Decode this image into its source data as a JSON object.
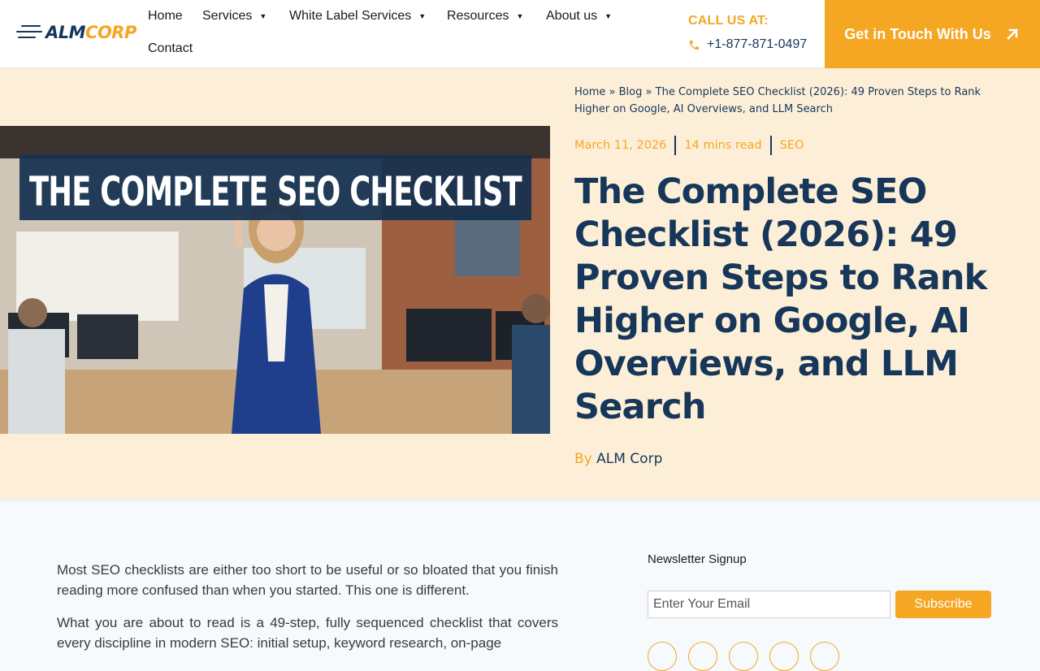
{
  "brand": {
    "alm": "ALM",
    "corp": "CORP"
  },
  "nav": [
    {
      "label": "Home",
      "has_dropdown": false
    },
    {
      "label": "Services",
      "has_dropdown": true
    },
    {
      "label": "White Label Services",
      "has_dropdown": true
    },
    {
      "label": "Resources",
      "has_dropdown": true
    },
    {
      "label": "About us",
      "has_dropdown": true
    },
    {
      "label": "Contact",
      "has_dropdown": false
    }
  ],
  "contact": {
    "label": "CALL US AT:",
    "phone": "+1-877-871-0497"
  },
  "cta": {
    "label": "Get in Touch With Us"
  },
  "hero": {
    "image_text": "THE COMPLETE SEO CHECKLIST",
    "breadcrumb": {
      "home": "Home",
      "blog": "Blog",
      "current": "The Complete SEO Checklist (2026): 49 Proven Steps to Rank Higher on Google, AI Overviews, and LLM Search",
      "separator": "»"
    },
    "date": "March 11, 2026",
    "read_time": "14 mins read",
    "category": "SEO",
    "title": "The Complete SEO Checklist (2026): 49 Proven Steps to Rank Higher on Google, AI Overviews, and LLM Search",
    "by": "By",
    "author": "ALM Corp"
  },
  "article": {
    "p1": "Most SEO checklists are either too short to be useful or so bloated that you finish reading more confused than when you started. This one is different.",
    "p2": "What you are about to read is a 49-step, fully sequenced checklist that covers every discipline in modern SEO: initial setup, keyword research, on-page"
  },
  "newsletter": {
    "title": "Newsletter Signup",
    "placeholder": "Enter Your Email",
    "button": "Subscribe"
  },
  "colors": {
    "accent": "#f5a623",
    "navy": "#16375a",
    "hero_bg": "#fdefd7"
  }
}
